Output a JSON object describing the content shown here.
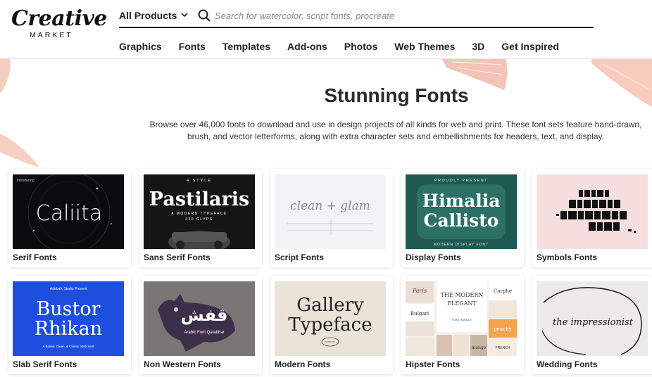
{
  "brand": {
    "logo_main": "Creative",
    "logo_sub": "MARKET"
  },
  "search": {
    "category": "All Products",
    "placeholder": "Search for watercolor, script fonts, procreate"
  },
  "nav": {
    "items": [
      "Graphics",
      "Fonts",
      "Templates",
      "Add-ons",
      "Photos",
      "Web Themes",
      "3D",
      "Get Inspired"
    ]
  },
  "hero": {
    "title": "Stunning Fonts",
    "description": "Browse over 46,000 fonts to download and use in design projects of all kinds for web and print. These font sets feature hand-drawn, brush, and vector letterforms, along with extra character sets and embellishments for headers, text, and display."
  },
  "categories": [
    {
      "label": "Serif Fonts",
      "thumb": {
        "main": "Caliita",
        "top": "Introducing",
        "bg": "#0b0b10",
        "fg": "#ffffff"
      }
    },
    {
      "label": "Sans Serif Fonts",
      "thumb": {
        "main": "Pastilaris",
        "top": "4 STYLE",
        "sub": "A MODERN TYPEFACE",
        "sub2": "430 GLYPS",
        "bg": "#151515",
        "fg": "#ffffff"
      }
    },
    {
      "label": "Script Fonts",
      "thumb": {
        "main": "clean + glam",
        "bg": "#f3f3f5",
        "fg": "#8a8a8a"
      }
    },
    {
      "label": "Display Fonts",
      "thumb": {
        "main1": "Himalia",
        "main2": "Callisto",
        "top": "PROUDLY PRESENT",
        "sub": "MODERN DISPLAY FONT",
        "bg": "#1f5a52",
        "fg": "#ffffff"
      }
    },
    {
      "label": "Symbols Fonts",
      "thumb": {
        "bg": "#f6dedf",
        "fg": "#111111"
      }
    },
    {
      "label": "Slab Serif Fonts",
      "thumb": {
        "main1": "Bustor",
        "main2": "Rhikan",
        "top": "Adebaik Studio Present",
        "sub": "A Bolder, Clean, & Classic Slab Serif",
        "bg": "#1e4ee0",
        "fg": "#ffffff"
      }
    },
    {
      "label": "Non Western Fonts",
      "thumb": {
        "sub": "Arabic Font Qatabhar",
        "bg": "#7b7676",
        "fg": "#ffffff"
      }
    },
    {
      "label": "Modern Fonts",
      "thumb": {
        "main1": "Gallery",
        "main2": "Typeface",
        "bg": "#eae3d8",
        "fg": "#222222"
      }
    },
    {
      "label": "Hipster Fonts",
      "thumb": {
        "t1": "THE MODERN",
        "t2": "ELEGANT",
        "t3": "FONT BUNDLE",
        "t4": "Carphe",
        "t5": "Paris",
        "t6": "Bulgari",
        "t7": "peachy",
        "t8": "mango",
        "t9": "FRENCH",
        "bg": "#f4efe9",
        "fg": "#333333"
      }
    },
    {
      "label": "Wedding Fonts",
      "thumb": {
        "main": "the impressionist",
        "bg": "#ecebea",
        "fg": "#111111"
      }
    }
  ],
  "colors": {
    "accent": "#222222",
    "brush": "#f2c4b6"
  }
}
